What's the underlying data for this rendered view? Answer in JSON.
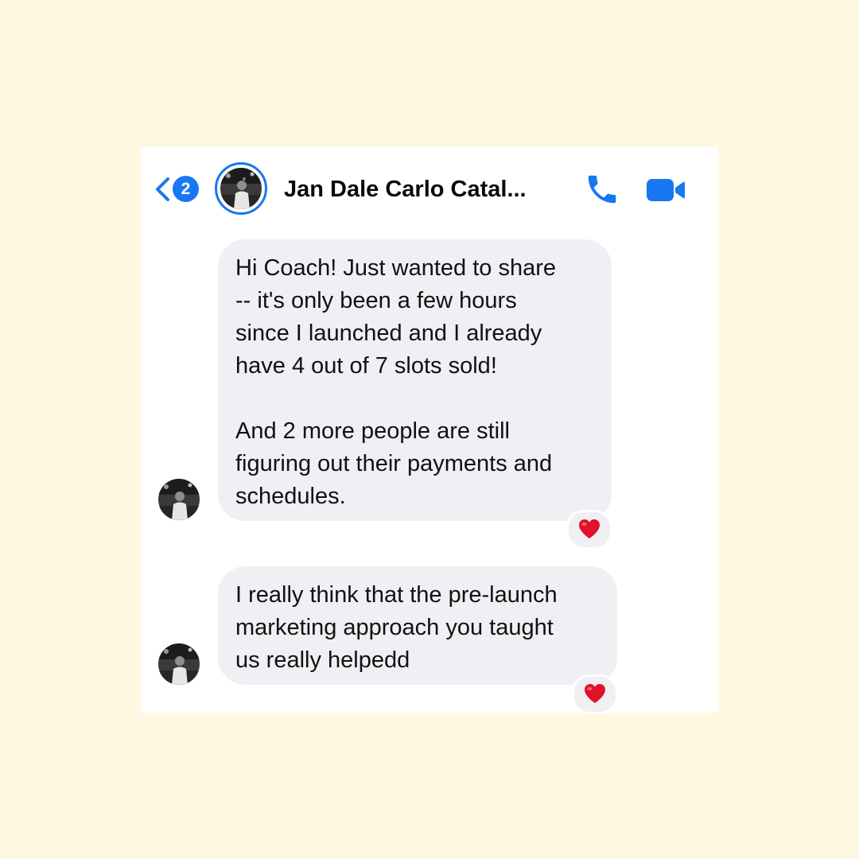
{
  "header": {
    "back_label": "Back",
    "unread_count": "2",
    "contact_name": "Jan Dale Carlo Catal...",
    "call_icon": "phone-icon",
    "video_icon": "video-camera-icon",
    "accent_color": "#1877f2"
  },
  "messages": [
    {
      "sender": "contact",
      "text": "Hi Coach! Just wanted to share\n-- it's only been a few hours\nsince I launched and I already\nhave 4 out of 7 slots sold!\n\nAnd 2 more people are still\nfiguring out their payments and\nschedules.",
      "reaction": "heart-reaction-icon"
    },
    {
      "sender": "contact",
      "text": "I really think that the pre-launch\nmarketing approach you taught\nus really helpedd",
      "reaction": "heart-reaction-icon"
    }
  ],
  "colors": {
    "page_background": "#fff8e1",
    "bubble_background": "#f0f0f4",
    "reaction_heart": "#e0112b"
  }
}
